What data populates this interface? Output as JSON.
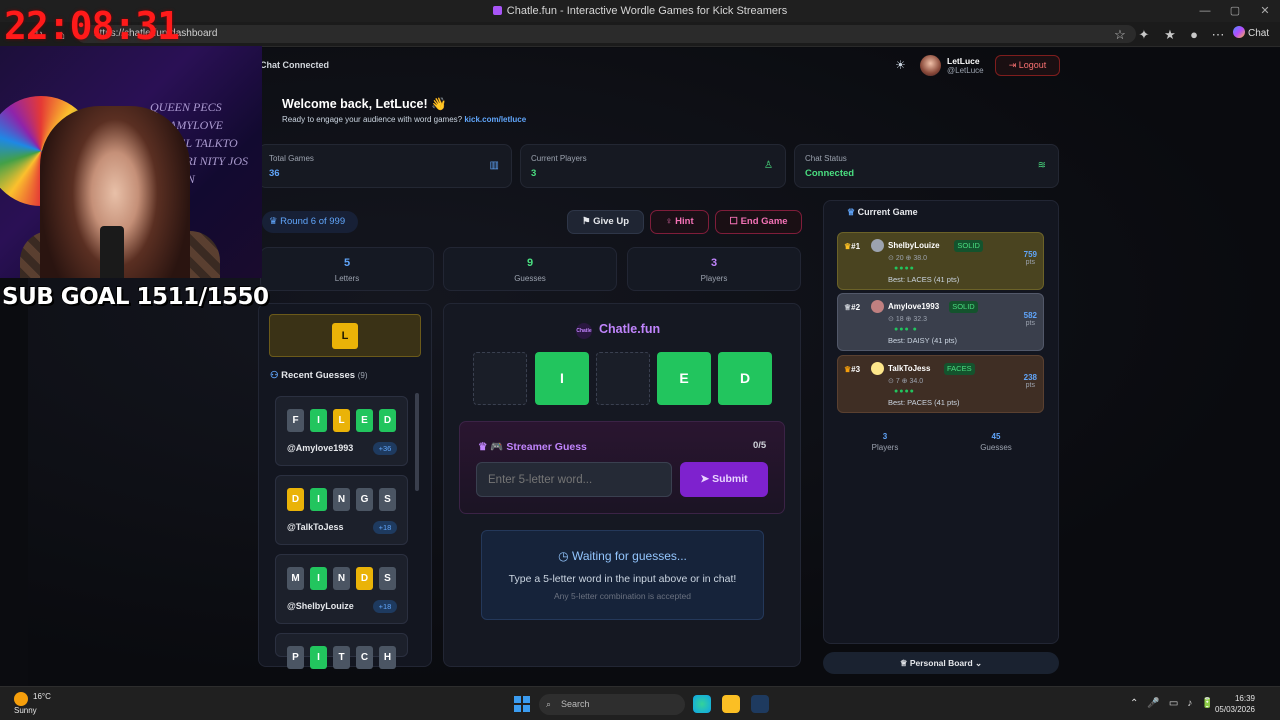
{
  "browser": {
    "title": "Chatle.fun - Interactive Wordle Games for Kick Streamers",
    "url": "https://chatle.fun/dashboard",
    "url_visible": "https://chatle.fun/dashboard",
    "chat_label": "Chat"
  },
  "header": {
    "chat_status": "Chat Connected",
    "user_name": "LetLuce",
    "user_handle": "@LetLuce",
    "logout_label": "Logout"
  },
  "welcome": {
    "title": "Welcome back, LetLuce! 👋",
    "subtitle": "Ready to engage your audience with word games?",
    "link": "kick.com/letluce"
  },
  "stats": [
    {
      "label": "Total Games",
      "value": "36",
      "color": "#60a5fa"
    },
    {
      "label": "Current Players",
      "value": "3",
      "color": "#4ade80"
    },
    {
      "label": "Chat Status",
      "value": "Connected",
      "color": "#4ade80"
    }
  ],
  "round": "Round 6 of 999",
  "actions": {
    "give_up": "Give Up",
    "hint": "Hint",
    "end_game": "End Game"
  },
  "mini_stats": [
    {
      "num": "5",
      "label": "Letters",
      "color": "#60a5fa"
    },
    {
      "num": "9",
      "label": "Guesses",
      "color": "#4ade80"
    },
    {
      "num": "3",
      "label": "Players",
      "color": "#c084fc"
    }
  ],
  "known_letter": "L",
  "recent": {
    "title": "Recent Guesses",
    "count": "(9)",
    "items": [
      {
        "letters": [
          "F",
          "I",
          "L",
          "E",
          "D"
        ],
        "colors": [
          "#4b5563",
          "#22c55e",
          "#eab308",
          "#22c55e",
          "#22c55e"
        ],
        "user": "@Amylove1993",
        "pts": "+36"
      },
      {
        "letters": [
          "D",
          "I",
          "N",
          "G",
          "S"
        ],
        "colors": [
          "#eab308",
          "#22c55e",
          "#4b5563",
          "#4b5563",
          "#4b5563"
        ],
        "user": "@TalkToJess",
        "pts": "+18"
      },
      {
        "letters": [
          "M",
          "I",
          "N",
          "D",
          "S"
        ],
        "colors": [
          "#4b5563",
          "#22c55e",
          "#4b5563",
          "#eab308",
          "#4b5563"
        ],
        "user": "@ShelbyLouize",
        "pts": "+18"
      },
      {
        "letters": [
          "P",
          "I",
          "T",
          "C",
          "H"
        ],
        "colors": [
          "#4b5563",
          "#22c55e",
          "#4b5563",
          "#4b5563",
          "#4b5563"
        ],
        "user": "",
        "pts": ""
      }
    ]
  },
  "board": {
    "logo": "Chatle.fun",
    "tiles": [
      "",
      "I",
      "",
      "E",
      "D"
    ],
    "states": [
      "empty",
      "green",
      "empty",
      "green",
      "green"
    ]
  },
  "streamer_guess": {
    "title": "Streamer Guess",
    "count": "0/5",
    "placeholder": "Enter 5-letter word...",
    "submit": "Submit"
  },
  "waiting": {
    "title": "Waiting for guesses...",
    "line1": "Type a 5-letter word in the input above or in chat!",
    "line2": "Any 5-letter combination is accepted"
  },
  "current_game": {
    "title": "Current Game",
    "players": [
      {
        "rank": "#1",
        "name": "ShelbyLouize",
        "word": "SOLID",
        "stats": "20 ⊕ 38.0",
        "dots": "●●●●",
        "best": "Best: LACES (41 pts)",
        "score": "759",
        "unit": "pts",
        "bg": "#4a4420",
        "border": "#6b6228",
        "avatar": "#9ca3af"
      },
      {
        "rank": "#2",
        "name": "Amylove1993",
        "word": "SOLID",
        "stats": "18 ⊕ 32.3",
        "dots": "●●●  ●",
        "best": "Best: DAISY (41 pts)",
        "score": "582",
        "unit": "pts",
        "bg": "#3a3f4c",
        "border": "#525869",
        "avatar": "#c08080"
      },
      {
        "rank": "#3",
        "name": "TalkToJess",
        "word": "FACES",
        "stats": "7 ⊕ 34.0",
        "dots": "●●●●",
        "best": "Best: PACES (41 pts)",
        "score": "238",
        "unit": "pts",
        "bg": "#3f2e24",
        "border": "#5a4030",
        "avatar": "#fde68a"
      }
    ],
    "totals": [
      {
        "num": "3",
        "label": "Players"
      },
      {
        "num": "45",
        "label": "Guesses"
      }
    ],
    "personal_board": "Personal Board"
  },
  "overlay": {
    "clock": "22:08:31",
    "sub_goal": "SUB GOAL 1511/1550",
    "wall_text": "QUEEN PECS  DR.AMYLOVE  DANIEL  TALKTO  RICHARI  NITY JOS  CAL KIN"
  },
  "taskbar": {
    "temp": "16°C",
    "weather": "Sunny",
    "search": "Search",
    "time": "16:39",
    "date": "05/03/2026"
  }
}
